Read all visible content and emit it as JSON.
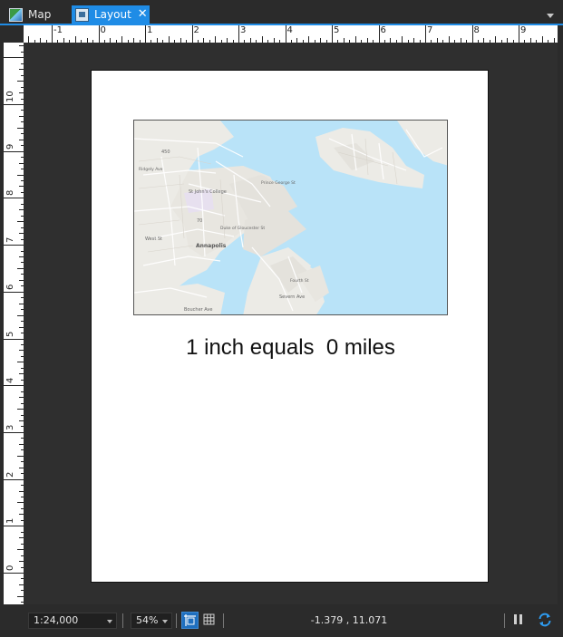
{
  "tabs": [
    {
      "label": "Map",
      "icon": "map-icon",
      "active": false
    },
    {
      "label": "Layout",
      "icon": "layout-icon",
      "active": true,
      "close_glyph": "✕"
    }
  ],
  "rulers": {
    "horizontal_labels": [
      "-1",
      "0",
      "1",
      "2",
      "3",
      "4",
      "5",
      "6",
      "7",
      "8",
      "9"
    ],
    "vertical_labels": [
      "10",
      "9",
      "8",
      "7",
      "6",
      "5",
      "4",
      "3",
      "2",
      "1",
      "0"
    ]
  },
  "layout": {
    "scale_text": "1 inch equals  0 miles",
    "map_labels": [
      "St John's College",
      "Annapolis",
      "West St",
      "Duke of Gloucester St",
      "Severn Ave",
      "Fourth St",
      "Prince George St",
      "450",
      "70",
      "Boucher Ave",
      "Ridgely Ave"
    ]
  },
  "status": {
    "scale": "1:24,000",
    "zoom": "54%",
    "coordinates": "-1.379 , 11.071"
  },
  "colors": {
    "accent": "#1f8ce6",
    "water": "#b9e3f8",
    "land": "#ecebe6"
  }
}
